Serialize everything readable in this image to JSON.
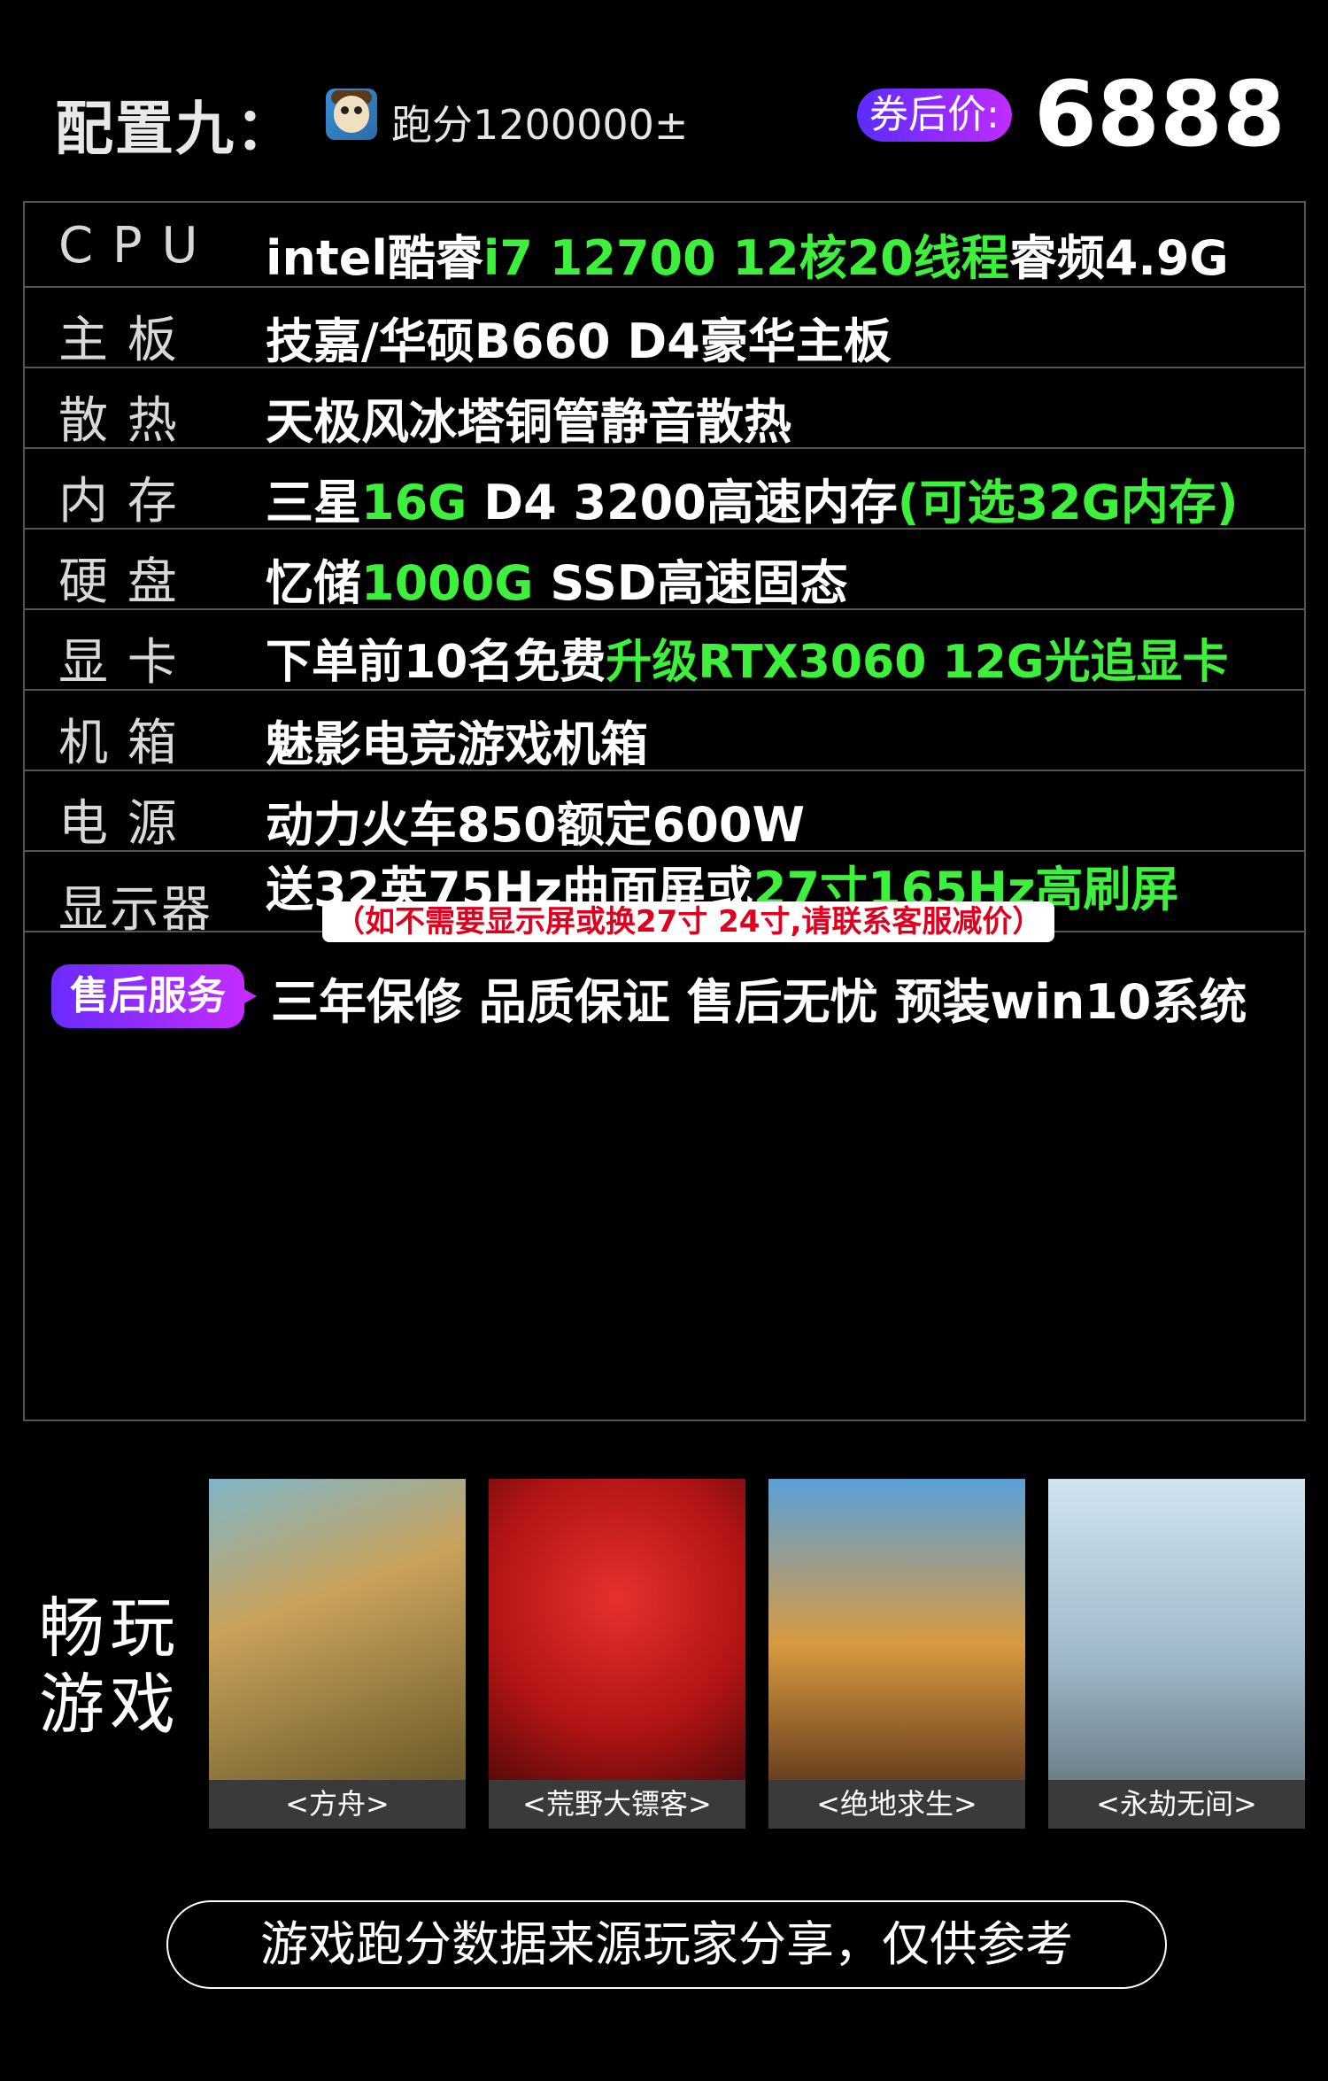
{
  "header": {
    "title": "配置九：",
    "score": "跑分1200000±",
    "coupon_label": "券后价:",
    "price": "6888"
  },
  "spec": {
    "cpu": {
      "label": "C P U",
      "v1": "intel酷睿",
      "v2": "i7 12700 12核20线程",
      "v3": "睿频4.9G"
    },
    "board": {
      "label": "主   板",
      "v1": "技嘉/华硕B660 D4豪华主板"
    },
    "cooling": {
      "label": "散   热",
      "v1": "天极风冰塔铜管静音散热"
    },
    "memory": {
      "label": "内   存",
      "v1": "三星",
      "v2": "16G",
      "v3": " D4 3200高速内存",
      "v4": "(可选32G内存)"
    },
    "disk": {
      "label": "硬   盘",
      "v1": "忆储",
      "v2": "1000G",
      "v3": " SSD高速固态"
    },
    "gpu": {
      "label": "显   卡",
      "v1": "下单前10名免费",
      "v2": "升级RTX3060 12G光追显卡"
    },
    "case": {
      "label": "机   箱",
      "v1": "魅影电竞游戏机箱"
    },
    "psu": {
      "label": "电   源",
      "v1": "动力火车850额定600W"
    },
    "monitor": {
      "label": "显示器",
      "v1": "送32英75Hz曲面屏或",
      "v2": "27寸165Hz高刷屏",
      "note": "（如不需要显示屏或换27寸 24寸,请联系客服减价）"
    },
    "service": {
      "badge": "售后服务",
      "v1": "三年保修 品质保证 售后无忧 预装win10系统"
    }
  },
  "games": {
    "title_line1": "畅玩",
    "title_line2": "游戏",
    "items": [
      {
        "caption": "<方舟>"
      },
      {
        "caption": "<荒野大镖客>"
      },
      {
        "caption": "<绝地求生>"
      },
      {
        "caption": "<永劫无间>"
      }
    ]
  },
  "footer": {
    "disclaimer": "游戏跑分数据来源玩家分享，仅供参考"
  }
}
